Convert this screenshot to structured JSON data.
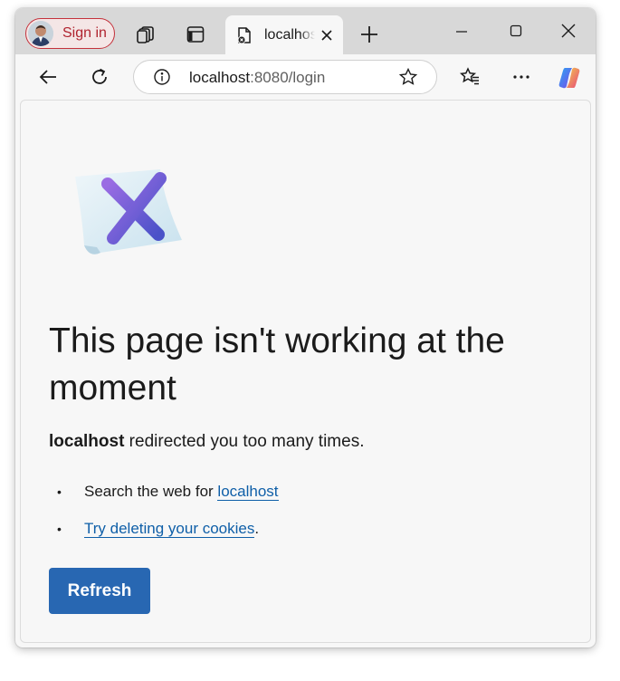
{
  "browser": {
    "sign_in_label": "Sign in",
    "tab": {
      "title": "localhost",
      "icon": "error-page-icon"
    },
    "address": {
      "host": "localhost",
      "rest": ":8080/login"
    },
    "icons": {
      "workspaces": "workspaces-icon",
      "tab_actions": "vertical-tabs-icon",
      "close_tab": "close-icon",
      "new_tab": "plus-icon",
      "minimize": "minimize-icon",
      "maximize": "maximize-icon",
      "close_window": "close-icon",
      "back": "back-arrow-icon",
      "refresh": "refresh-icon",
      "site_info": "info-icon",
      "favorite": "star-icon",
      "favorites": "favorites-icon",
      "more": "more-icon",
      "copilot": "copilot-icon"
    }
  },
  "page": {
    "headline": "This page isn't working at the moment",
    "host_bold": "localhost",
    "message_rest": " redirected you too many times.",
    "suggestions": {
      "search_prefix": "Search the web for ",
      "search_link": "localhost",
      "cookies_link": "Try deleting your cookies",
      "cookies_suffix": "."
    },
    "refresh_label": "Refresh"
  },
  "colors": {
    "accent": "#2867b2",
    "link": "#0f5fa8",
    "signin": "#b0232f"
  }
}
